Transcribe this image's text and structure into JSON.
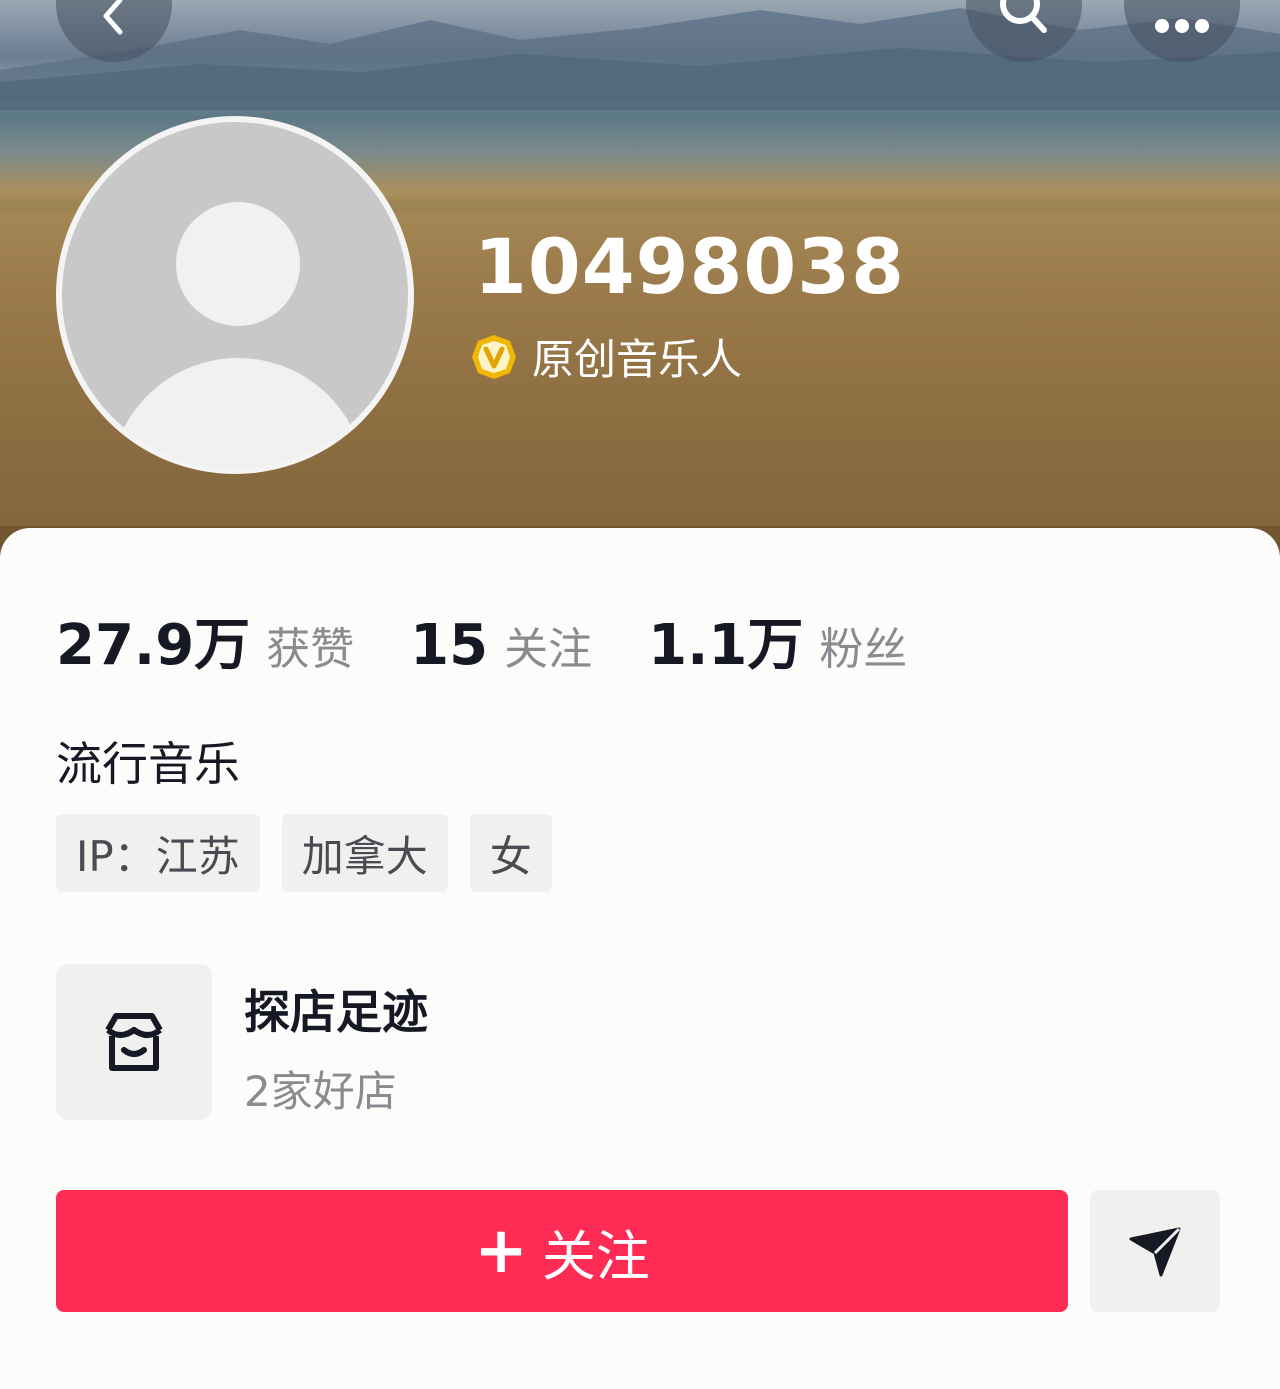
{
  "header": {
    "back_icon": "chevron-left-icon",
    "search_icon": "search-icon",
    "more_icon": "more-dots-icon"
  },
  "profile": {
    "nickname": "10498038",
    "verified_icon": "verified-v-badge-icon",
    "verified_color": "#f2b705",
    "verified_label": "原创音乐人"
  },
  "stats": [
    {
      "value": "27.9万",
      "label": "获赞"
    },
    {
      "value": "15",
      "label": "关注"
    },
    {
      "value": "1.1万",
      "label": "粉丝"
    }
  ],
  "bio": "流行音乐",
  "tags": [
    "IP：江苏",
    "加拿大",
    "女"
  ],
  "shop": {
    "icon": "store-icon",
    "title": "探店足迹",
    "subtitle": "2家好店"
  },
  "actions": {
    "follow_label": "关注",
    "follow_color": "#fe2c55",
    "share_icon": "send-arrow-icon"
  }
}
